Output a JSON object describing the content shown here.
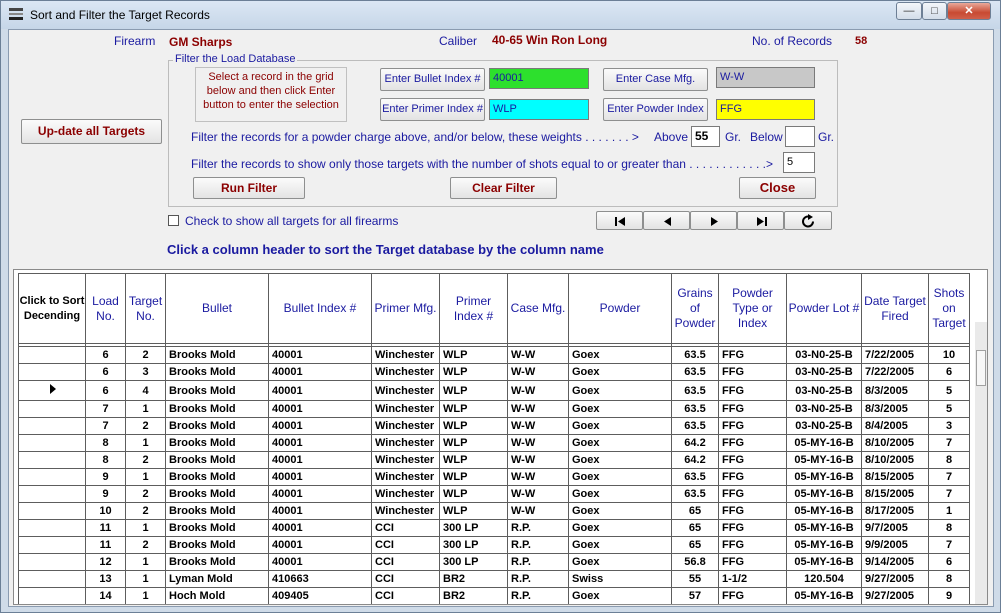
{
  "window": {
    "title": "Sort and Filter the Target Records",
    "minimize": "—",
    "maximize": "□",
    "close": "✕"
  },
  "header": {
    "firearm_label": "Firearm",
    "firearm_value": "GM Sharps",
    "caliber_label": "Caliber",
    "caliber_value": "40-65 Win Ron Long",
    "records_label": "No. of Records",
    "records_value": "58"
  },
  "filter": {
    "group_title": "Filter the Load Database",
    "instructions": "Select a record in the grid below and then click Enter button to enter the selection",
    "bullet_btn": "Enter Bullet Index #",
    "bullet_value": "40001",
    "case_btn": "Enter Case Mfg.",
    "case_value": "W-W",
    "primer_btn": "Enter Primer Index #",
    "primer_value": "WLP",
    "powder_btn": "Enter Powder Index",
    "powder_value": "FFG",
    "charge_text": "Filter the records for a powder charge above, and/or below, these weights . . . . . . . >",
    "above_label": "Above",
    "above_value": "55",
    "gr1": "Gr.",
    "below_label": "Below",
    "below_value": "",
    "gr2": "Gr.",
    "shots_text": "Filter the records to show only those targets with the number of shots equal to or greater than . . . . . . . . . . . .>",
    "shots_value": "5",
    "run_btn": "Run Filter",
    "clear_btn": "Clear Filter",
    "close_btn": "Close"
  },
  "update_btn": "Up-date all Targets",
  "show_all_label": "Check to show all targets for all firearms",
  "sort_hint": "Click a column header to sort the Target database by the column name",
  "nav_icons": [
    "first-record-icon",
    "previous-record-icon",
    "next-record-icon",
    "last-record-icon",
    "refresh-icon"
  ],
  "grid": {
    "headers": [
      "Click to Sort Decending",
      "Load No.",
      "Target No.",
      "Bullet",
      "Bullet Index #",
      "Primer Mfg.",
      "Primer Index #",
      "Case Mfg.",
      "Powder",
      "Grains of Powder",
      "Powder Type or Index",
      "Powder Lot #",
      "Date Target Fired",
      "Shots on Target"
    ],
    "rows": [
      [
        "6",
        "2",
        "Brooks Mold",
        "40001",
        "Winchester",
        "WLP",
        "W-W",
        "Goex",
        "63.5",
        "FFG",
        "03-N0-25-B",
        "7/22/2005",
        "10"
      ],
      [
        "6",
        "3",
        "Brooks Mold",
        "40001",
        "Winchester",
        "WLP",
        "W-W",
        "Goex",
        "63.5",
        "FFG",
        "03-N0-25-B",
        "7/22/2005",
        "6"
      ],
      [
        "6",
        "4",
        "Brooks Mold",
        "40001",
        "Winchester",
        "WLP",
        "W-W",
        "Goex",
        "63.5",
        "FFG",
        "03-N0-25-B",
        "8/3/2005",
        "5"
      ],
      [
        "7",
        "1",
        "Brooks Mold",
        "40001",
        "Winchester",
        "WLP",
        "W-W",
        "Goex",
        "63.5",
        "FFG",
        "03-N0-25-B",
        "8/3/2005",
        "5"
      ],
      [
        "7",
        "2",
        "Brooks Mold",
        "40001",
        "Winchester",
        "WLP",
        "W-W",
        "Goex",
        "63.5",
        "FFG",
        "03-N0-25-B",
        "8/4/2005",
        "3"
      ],
      [
        "8",
        "1",
        "Brooks Mold",
        "40001",
        "Winchester",
        "WLP",
        "W-W",
        "Goex",
        "64.2",
        "FFG",
        "05-MY-16-B",
        "8/10/2005",
        "7"
      ],
      [
        "8",
        "2",
        "Brooks Mold",
        "40001",
        "Winchester",
        "WLP",
        "W-W",
        "Goex",
        "64.2",
        "FFG",
        "05-MY-16-B",
        "8/10/2005",
        "8"
      ],
      [
        "9",
        "1",
        "Brooks Mold",
        "40001",
        "Winchester",
        "WLP",
        "W-W",
        "Goex",
        "63.5",
        "FFG",
        "05-MY-16-B",
        "8/15/2005",
        "7"
      ],
      [
        "9",
        "2",
        "Brooks Mold",
        "40001",
        "Winchester",
        "WLP",
        "W-W",
        "Goex",
        "63.5",
        "FFG",
        "05-MY-16-B",
        "8/15/2005",
        "7"
      ],
      [
        "10",
        "2",
        "Brooks Mold",
        "40001",
        "Winchester",
        "WLP",
        "W-W",
        "Goex",
        "65",
        "FFG",
        "05-MY-16-B",
        "8/17/2005",
        "1"
      ],
      [
        "11",
        "1",
        "Brooks Mold",
        "40001",
        "CCI",
        "300 LP",
        "R.P.",
        "Goex",
        "65",
        "FFG",
        "05-MY-16-B",
        "9/7/2005",
        "8"
      ],
      [
        "11",
        "2",
        "Brooks Mold",
        "40001",
        "CCI",
        "300 LP",
        "R.P.",
        "Goex",
        "65",
        "FFG",
        "05-MY-16-B",
        "9/9/2005",
        "7"
      ],
      [
        "12",
        "1",
        "Brooks Mold",
        "40001",
        "CCI",
        "300 LP",
        "R.P.",
        "Goex",
        "56.8",
        "FFG",
        "05-MY-16-B",
        "9/14/2005",
        "6"
      ],
      [
        "13",
        "1",
        "Lyman Mold",
        "410663",
        "CCI",
        "BR2",
        "R.P.",
        "Swiss",
        "55",
        "1-1/2",
        "120.504",
        "9/27/2005",
        "8"
      ],
      [
        "14",
        "1",
        "Hoch Mold",
        "409405",
        "CCI",
        "BR2",
        "R.P.",
        "Goex",
        "57",
        "FFG",
        "05-MY-16-B",
        "9/27/2005",
        "9"
      ]
    ],
    "current_row_index": 2
  }
}
